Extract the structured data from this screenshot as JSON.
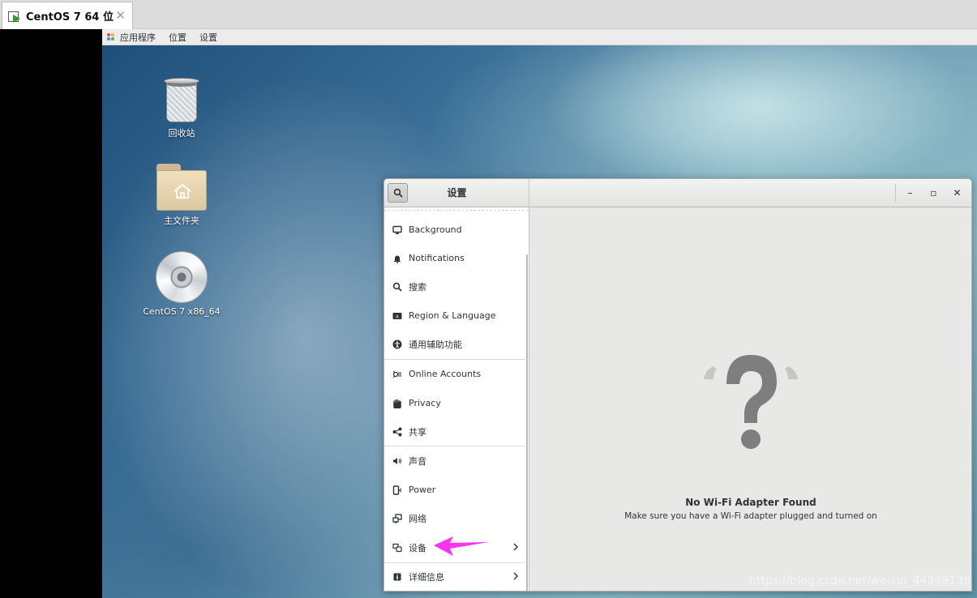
{
  "vm_tab": {
    "title": "CentOS 7 64 位",
    "close": "✕"
  },
  "topbar": {
    "applications": "应用程序",
    "places": "位置",
    "settings": "设置"
  },
  "desktop": {
    "trash_label": "回收站",
    "home_label": "主文件夹",
    "disc_label": "CentOS 7 x86_64"
  },
  "settings_window": {
    "title": "设置",
    "controls": {
      "minimize": "–",
      "maximize": "▫",
      "close": "✕"
    },
    "sidebar": [
      {
        "label": "Background",
        "icon": "background-icon"
      },
      {
        "label": "Notifications",
        "icon": "bell-icon"
      },
      {
        "label": "搜索",
        "icon": "search-icon"
      },
      {
        "label": "Region & Language",
        "icon": "region-icon"
      },
      {
        "label": "通用辅助功能",
        "icon": "accessibility-icon"
      },
      {
        "label": "Online Accounts",
        "icon": "online-accounts-icon"
      },
      {
        "label": "Privacy",
        "icon": "hand-icon"
      },
      {
        "label": "共享",
        "icon": "share-icon"
      },
      {
        "label": "声音",
        "icon": "speaker-icon"
      },
      {
        "label": "Power",
        "icon": "power-icon"
      },
      {
        "label": "网络",
        "icon": "network-icon"
      },
      {
        "label": "设备",
        "icon": "devices-icon"
      },
      {
        "label": "详细信息",
        "icon": "info-icon"
      }
    ],
    "empty_state": {
      "title": "No Wi-Fi Adapter Found",
      "subtitle": "Make sure you have a Wi-Fi adapter plugged and turned on"
    }
  },
  "watermark": "https://blog.csdn.net/weixin_44949135",
  "colors": {
    "annotation_arrow": "#ff33ee",
    "accent_green": "#2c9f2c"
  }
}
